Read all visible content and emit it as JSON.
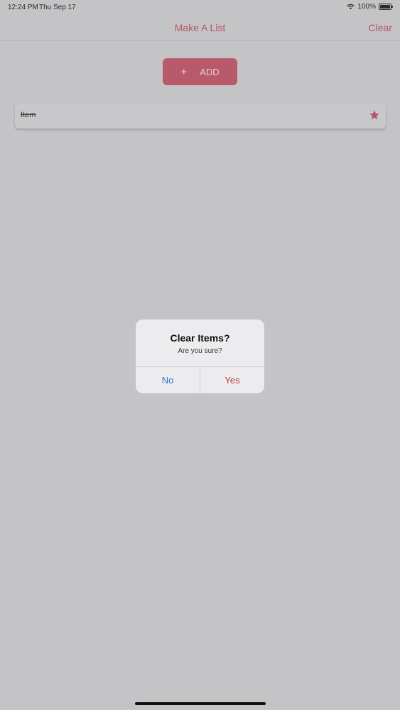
{
  "status_bar": {
    "time": "12:24 PM",
    "date": "Thu Sep 17",
    "battery": "100%",
    "battery_level": 1.0,
    "wifi_icon": "wifi-icon",
    "battery_icon": "battery-icon"
  },
  "nav": {
    "title": "Make A List",
    "clear_label": "Clear"
  },
  "add_button": {
    "icon": "+",
    "label": "ADD"
  },
  "list": {
    "items": [
      {
        "label": "Item",
        "starred": true,
        "completed": true
      }
    ]
  },
  "alert": {
    "title": "Clear Items?",
    "message": "Are you sure?",
    "no_label": "No",
    "yes_label": "Yes"
  },
  "colors": {
    "accent": "#b5566b",
    "background": "#c4c3c5",
    "no_button": "#2f6fc5",
    "yes_button": "#c23b3b"
  }
}
